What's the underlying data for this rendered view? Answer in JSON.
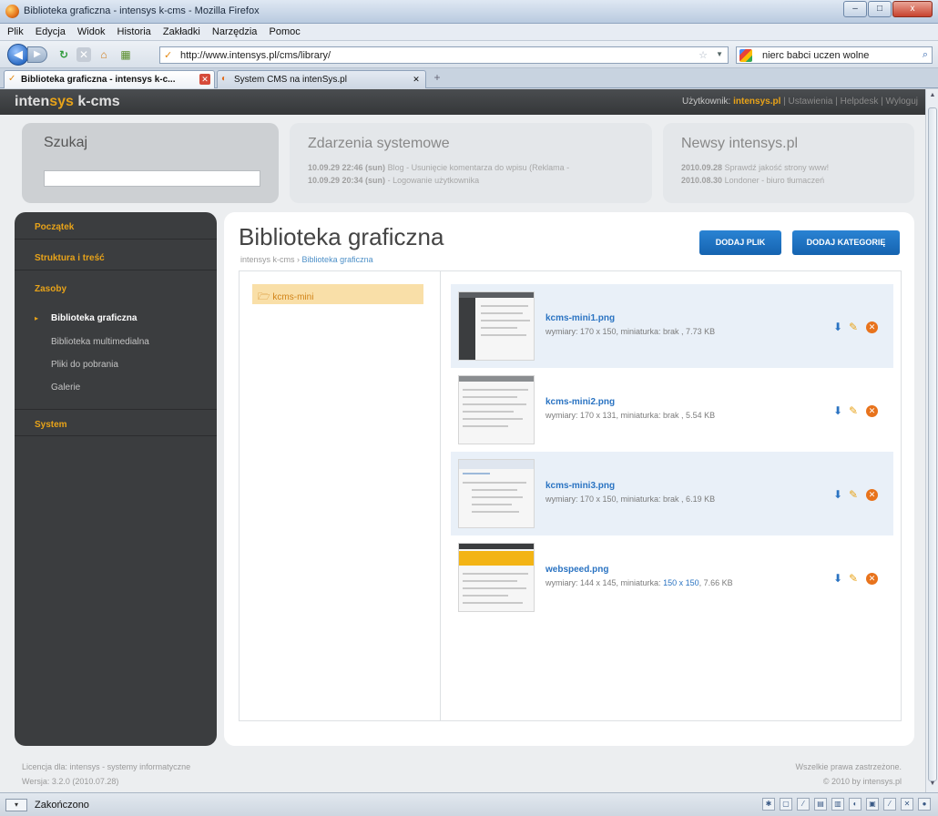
{
  "window": {
    "title": "Biblioteka graficzna - intensys k-cms - Mozilla Firefox",
    "minimize": "–",
    "maximize": "□",
    "close": "x"
  },
  "menu": [
    "Plik",
    "Edycja",
    "Widok",
    "Historia",
    "Zakładki",
    "Narzędzia",
    "Pomoc"
  ],
  "address": {
    "url": "http://www.intensys.pl/cms/library/",
    "search_query": "nierc babci uczen wolne"
  },
  "tabs": [
    {
      "label": "Biblioteka graficzna - intensys k-c...",
      "active": true
    },
    {
      "label": "System CMS na intenSys.pl",
      "active": false
    }
  ],
  "header": {
    "logo_a": "inten",
    "logo_b": "sys",
    "logo_c": " k-cms",
    "user_label": "Użytkownik:",
    "user_name": "intensys.pl",
    "links": [
      "Ustawienia",
      "Helpdesk",
      "Wyloguj"
    ],
    "separator": "|"
  },
  "search_panel": {
    "label": "Szukaj",
    "value": ""
  },
  "events_panel": {
    "title": "Zdarzenia systemowe",
    "items": [
      {
        "time": "10.09.29 22:46 (sun)",
        "text": "Blog - Usunięcie komentarza do wpisu (Reklama -"
      },
      {
        "time": "10.09.29 20:34 (sun)",
        "text": "- Logowanie użytkownika"
      }
    ]
  },
  "news_panel": {
    "title": "Newsy intensys.pl",
    "items": [
      {
        "date": "2010.09.28",
        "text": "Sprawdź jakość strony www!"
      },
      {
        "date": "2010.08.30",
        "text": "Londoner - biuro tłumaczeń"
      }
    ]
  },
  "sidebar": {
    "sections": [
      "Początek",
      "Struktura i treść",
      "Zasoby",
      "System"
    ],
    "zasoby_items": [
      "Biblioteka graficzna",
      "Biblioteka multimedialna",
      "Pliki do pobrania",
      "Galerie"
    ]
  },
  "main": {
    "title": "Biblioteka graficzna",
    "breadcrumb_root": "intensys k-cms",
    "breadcrumb_sep": "›",
    "breadcrumb_current": "Biblioteka graficzna",
    "btn_add_file": "DODAJ PLIK",
    "btn_add_category": "DODAJ KATEGORIĘ",
    "folder": "kcms-mini",
    "folder_icon": "folder-icon"
  },
  "files": [
    {
      "name": "kcms-mini1.png",
      "meta": "wymiary: 170 x 150, miniaturka: brak , 7.73 KB"
    },
    {
      "name": "kcms-mini2.png",
      "meta": "wymiary: 170 x 131, miniaturka: brak , 5.54 KB"
    },
    {
      "name": "kcms-mini3.png",
      "meta": "wymiary: 170 x 150, miniaturka: brak , 6.19 KB"
    },
    {
      "name": "webspeed.png",
      "meta_a": "wymiary: 144 x 145, miniaturka:",
      "meta_link": "150 x 150",
      "meta_b": ", 7.66 KB"
    }
  ],
  "footer": {
    "license_label": "Licencja dla:",
    "license_value": "intensys - systemy informatyczne",
    "version_label": "Wersja:",
    "version_value": "3.2.0 (2010.07.28)",
    "rights": "Wszelkie prawa zastrzeżone.",
    "copyright": "© 2010 by intensys.pl"
  },
  "status": {
    "text": "Zakończono"
  },
  "colors": {
    "accent": "#e8a319",
    "link": "#2a73c2",
    "button": "#1b6fc0",
    "sidebar_bg": "#3b3d3f"
  }
}
